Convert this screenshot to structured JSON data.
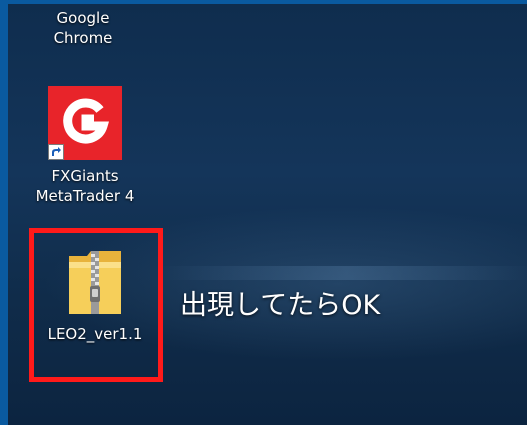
{
  "desktop": {
    "icons": [
      {
        "label": "Google Chrome",
        "icon": "chrome-shortcut-icon"
      },
      {
        "label": "FXGiants\nMetaTrader 4",
        "icon": "fxgiants-logo-icon",
        "brand_color": "#e8242a"
      },
      {
        "label": "LEO2_ver1.1",
        "icon": "zip-folder-icon",
        "folder_color": "#f3c94d"
      }
    ]
  },
  "annotation": {
    "text": "出現してたらOK",
    "highlight_color": "#ff1a1a"
  }
}
